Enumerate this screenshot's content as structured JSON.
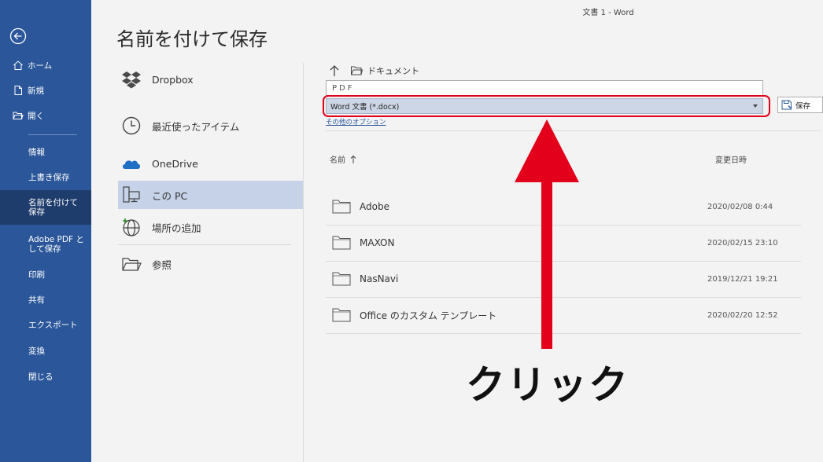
{
  "window": {
    "title": "文書 1  -  Word"
  },
  "page": {
    "title": "名前を付けて保存"
  },
  "sidebar": {
    "bg_color": "#2b579a",
    "active_color": "#1f3d6c",
    "items": [
      {
        "label": "ホーム",
        "icon": "home-icon"
      },
      {
        "label": "新規",
        "icon": "new-document-icon"
      },
      {
        "label": "開く",
        "icon": "open-folder-icon"
      },
      {
        "label": "情報"
      },
      {
        "label": "上書き保存"
      },
      {
        "label": "名前を付けて保存"
      },
      {
        "label": "Adobe PDF として保存"
      },
      {
        "label": "印刷"
      },
      {
        "label": "共有"
      },
      {
        "label": "エクスポート"
      },
      {
        "label": "変換"
      },
      {
        "label": "閉じる"
      }
    ]
  },
  "locations": [
    {
      "label": "Dropbox",
      "icon": "dropbox-icon"
    },
    {
      "label": "最近使ったアイテム",
      "icon": "clock-icon"
    },
    {
      "label": "OneDrive",
      "icon": "cloud-icon"
    },
    {
      "label": "この PC",
      "icon": "computer-icon",
      "selected": true
    },
    {
      "label": "場所の追加",
      "icon": "globe-add-icon"
    },
    {
      "label": "参照",
      "icon": "browse-folder-icon"
    }
  ],
  "file_panel": {
    "path": "ドキュメント",
    "filename_value": "PDF",
    "filetype_value": "Word 文書 (*.docx)",
    "save_label": "保存",
    "more_options": "その他のオプション",
    "col_name": "名前",
    "col_modified": "変更日時",
    "files": [
      {
        "name": "Adobe",
        "date": "2020/02/08 0:44"
      },
      {
        "name": "MAXON",
        "date": "2020/02/15 23:10"
      },
      {
        "name": "NasNavi",
        "date": "2019/12/21 19:21"
      },
      {
        "name": "Office のカスタム テンプレート",
        "date": "2020/02/20 12:52"
      }
    ]
  },
  "annotation": {
    "label": "クリック",
    "color": "#e3001b"
  }
}
